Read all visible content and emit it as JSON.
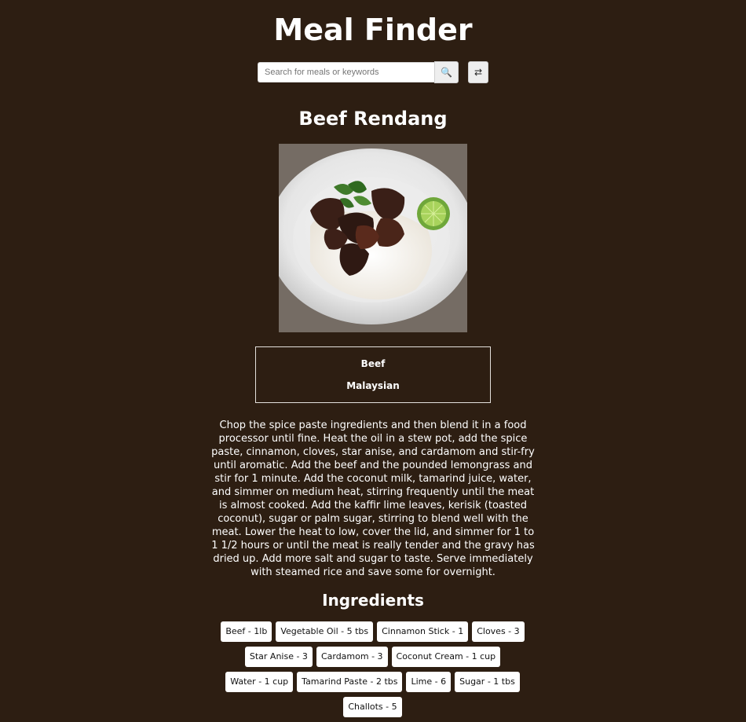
{
  "header": {
    "title": "Meal Finder"
  },
  "search": {
    "placeholder": "Search for meals or keywords",
    "value": "",
    "search_icon": "🔍",
    "random_icon": "⇄"
  },
  "meal": {
    "name": "Beef Rendang",
    "image_alt": "Beef Rendang",
    "category": "Beef",
    "area": "Malaysian",
    "instructions": "Chop the spice paste ingredients and then blend it in a food processor until fine. Heat the oil in a stew pot, add the spice paste, cinnamon, cloves, star anise, and cardamom and stir-fry until aromatic. Add the beef and the pounded lemongrass and stir for 1 minute. Add the coconut milk, tamarind juice, water, and simmer on medium heat, stirring frequently until the meat is almost cooked. Add the kaffir lime leaves, kerisik (toasted coconut), sugar or palm sugar, stirring to blend well with the meat. Lower the heat to low, cover the lid, and simmer for 1 to 1 1/2 hours or until the meat is really tender and the gravy has dried up. Add more salt and sugar to taste. Serve immediately with steamed rice and save some for overnight.",
    "ingredients_title": "Ingredients",
    "ingredients": [
      "Beef - 1lb",
      "Vegetable Oil - 5 tbs",
      "Cinnamon Stick - 1",
      "Cloves - 3",
      "Star Anise - 3",
      "Cardamom - 3",
      "Coconut Cream - 1 cup",
      "Water - 1 cup",
      "Tamarind Paste - 2 tbs",
      "Lime - 6",
      "Sugar - 1 tbs",
      "Challots - 5"
    ]
  }
}
